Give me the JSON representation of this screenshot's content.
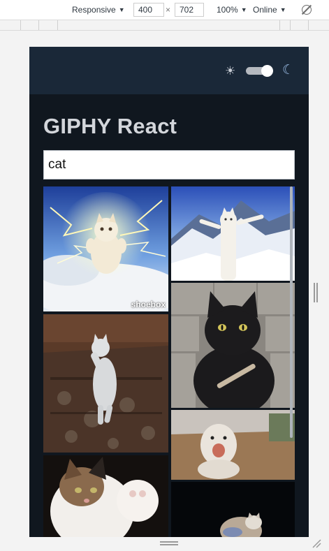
{
  "devtools": {
    "device": "Responsive",
    "width": "400",
    "height": "702",
    "times": "×",
    "zoom": "100%",
    "network": "Online",
    "caret": "▼"
  },
  "app": {
    "title": "GIPHY React",
    "theme_light_icon": "☀",
    "theme_dark_icon": "☾",
    "theme_dark_enabled": true,
    "search": {
      "value": "cat",
      "placeholder": ""
    },
    "gifs": [
      {
        "subject": "lightning kitten",
        "watermark": "shoebox",
        "watermark_icon": "shoebox-logo"
      },
      {
        "subject": "longcat in snowy mountains",
        "watermark": ""
      },
      {
        "subject": "white cat dancing on rug",
        "watermark": ""
      },
      {
        "subject": "black cat with nail file",
        "watermark": ""
      },
      {
        "subject": "fluffy dog with mouth open",
        "watermark": ""
      },
      {
        "subject": "calico kitten",
        "watermark": ""
      },
      {
        "subject": "cat on dark background",
        "watermark": ""
      }
    ]
  },
  "colors": {
    "header_bg": "#1a2838",
    "page_bg": "#10171f",
    "title_text": "#d3d6db"
  }
}
